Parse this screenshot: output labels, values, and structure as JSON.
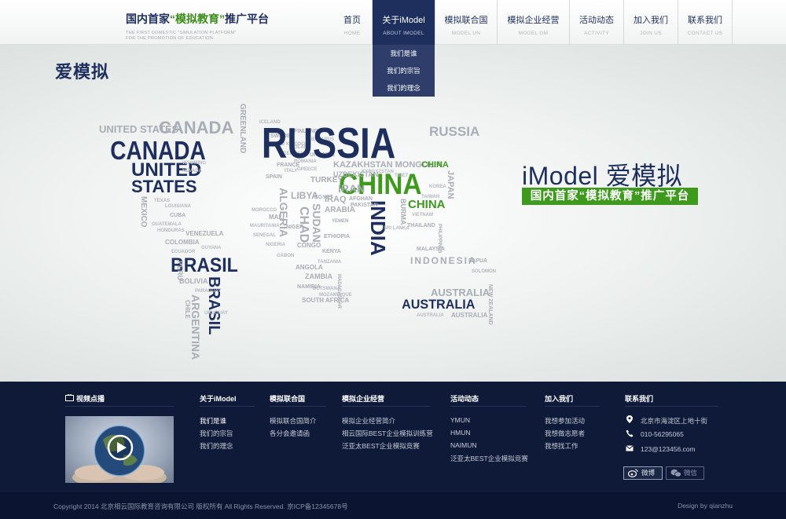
{
  "brand": {
    "logo_text": "iModel",
    "logo_cn": "爱模拟",
    "slogan_prefix": "国内首家",
    "slogan_highlight": "“模拟教育”",
    "slogan_suffix": "推广平台",
    "slogan_en_line1": "THE FIRST DOMESTIC \"SIMULATION PLATFORM\"",
    "slogan_en_line2": "FOR THE PROMOTION OF EDUCATION"
  },
  "nav": [
    {
      "cn": "首页",
      "en": "HOME"
    },
    {
      "cn": "关于iModel",
      "en": "ABOUT IMODEL"
    },
    {
      "cn": "模拟联合国",
      "en": "MODEL UN"
    },
    {
      "cn": "模拟企业经营",
      "en": "MODEL GM"
    },
    {
      "cn": "活动动态",
      "en": "ACTIVITY"
    },
    {
      "cn": "加入我们",
      "en": "JOIN US"
    },
    {
      "cn": "联系我们",
      "en": "CONTACT US"
    }
  ],
  "dropdown": [
    "我们是谁",
    "我们的宗旨",
    "我们的理念"
  ],
  "banner": {
    "title": "iModel 爱模拟",
    "badge": "国内首家“模拟教育”推广平台",
    "map_words": {
      "canada": "CANADA",
      "canada_small": "CANADA",
      "united_states_small": "UNITED STATES",
      "united": "UNITED",
      "states": "STATES",
      "greenland": "GREENLAND",
      "russia": "RUSSIA",
      "russia_small": "RUSSIA",
      "china": "CHINA",
      "china_small1": "CHINA",
      "china_small2": "CHINA",
      "india": "INDIA",
      "kazakhstan": "KAZAKHSTAN MONGOLIA",
      "brasil": "BRASIL",
      "brasil_v": "BRASIL",
      "argentina": "ARGENTINA",
      "indonesia": "INDONESIA",
      "australia": "AUSTRALIA",
      "australia_small": "AUSTRALIA",
      "australia_small2": "AUSTRALIA",
      "japan": "JAPAN",
      "iran": "IRAN",
      "iraq": "IRAQ",
      "turkey": "TURKEY",
      "libya": "LIBYA",
      "sudan": "SUDAN",
      "chad": "CHAD",
      "algeria": "ALGERIA",
      "mexico": "MEXICO",
      "peru": "PERU",
      "bolivia": "BOLIVIA",
      "zambia": "ZAMBIA",
      "kenya": "KENYA",
      "burma": "BURMA",
      "malaysia": "MALAYSIA",
      "new_zealand": "NEW ZEALAND",
      "uzbekistan": "UZBEKISTAN",
      "pakistan": "PAKISTAN",
      "arabia": "ARABIA",
      "ukraine": "UKRAINE",
      "france": "FRANCE",
      "spain": "SPAIN",
      "sweden": "SWEDEN",
      "finland": "FINLAND",
      "egypt": "EGYPT",
      "niger": "NIGER",
      "mali": "MALI",
      "angola": "ANGOLA",
      "namibia": "NAMIBIA",
      "south_africa": "SOUTH AFRICA",
      "madagascar": "MADAGASCAR",
      "venezuela": "VENEZUELA",
      "colombia": "COLOMBIA",
      "chile": "CHILE",
      "cuba": "CUBA",
      "afghan": "AFGHAN",
      "thailand": "THAILAND",
      "philippines": "PHILIPPINES",
      "papua": "PAPUA",
      "yemen": "YEMEN",
      "ethiopia": "ETHIOPIA",
      "congo": "CONGO"
    }
  },
  "footer": {
    "video": {
      "title": "视频点播"
    },
    "columns": [
      {
        "title": "关于iModel",
        "links": [
          "我们是谁",
          "我们的宗旨",
          "我们的理念"
        ]
      },
      {
        "title": "模拟联合国",
        "links": [
          "模拟联合国简介",
          "各分会邀请函"
        ]
      },
      {
        "title": "模拟企业经营",
        "links": [
          "模拟企业经营简介",
          "相云国际BEST企业模拟训练营",
          "泛亚太BEST企业模拟竞赛"
        ]
      },
      {
        "title": "活动动态",
        "links": [
          "YMUN",
          "HMUN",
          "NAIMUN",
          "泛亚太BEST企业模拟竞赛"
        ]
      },
      {
        "title": "加入我们",
        "links": [
          "我想参加活动",
          "我想做志愿者",
          "我想找工作"
        ]
      }
    ],
    "contact": {
      "title": "联系我们",
      "address": "北京市海淀区上地十街",
      "phone": "010-56295065",
      "email": "123@123456.com",
      "weibo": "微博",
      "weixin": "微信"
    },
    "copyright": "Copyright 2014 北京相云国际教育咨询有限公司 版权所有 All Rights Reserved.   京ICP备12345678号",
    "design": "Design by qianzhu"
  },
  "colors": {
    "navy": "#1e2f5e",
    "green": "#3d9a1c",
    "footer_bg": "#0f1a39",
    "map_gray": "#a9adb5"
  }
}
